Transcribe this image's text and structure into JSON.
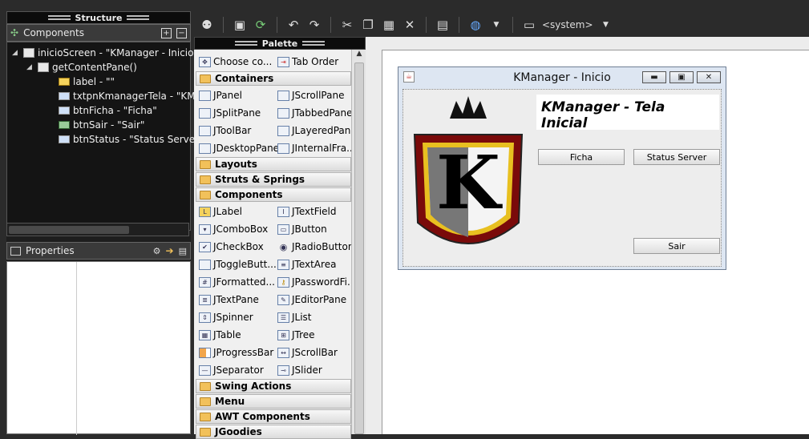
{
  "structure": {
    "title": "Structure",
    "components_header": "Components",
    "tree": [
      {
        "label": "inicioScreen - \"KManager - Inicio\""
      },
      {
        "label": "getContentPane()"
      },
      {
        "label": "label - \"\""
      },
      {
        "label": "txtpnKmanagerTela - \"KMa"
      },
      {
        "label": "btnFicha - \"Ficha\""
      },
      {
        "label": "btnSair - \"Sair\""
      },
      {
        "label": "btnStatus - \"Status Server\""
      }
    ]
  },
  "properties": {
    "header": "Properties"
  },
  "toolbar": {
    "system_combo": "<system>"
  },
  "palette": {
    "title": "Palette",
    "top_items": [
      "Choose co...",
      "Tab Order"
    ],
    "categories": {
      "containers": "Containers",
      "layouts": "Layouts",
      "struts": "Struts & Springs",
      "components": "Components",
      "swing_actions": "Swing Actions",
      "menu": "Menu",
      "awt": "AWT Components",
      "jgoodies": "JGoodies"
    },
    "containers": [
      "JPanel",
      "JScrollPane",
      "JSplitPane",
      "JTabbedPane",
      "JToolBar",
      "JLayeredPane",
      "JDesktopPane",
      "JInternalFra..."
    ],
    "components": [
      "JLabel",
      "JTextField",
      "JComboBox",
      "JButton",
      "JCheckBox",
      "JRadioButton",
      "JToggleButt...",
      "JTextArea",
      "JFormatted...",
      "JPasswordFi...",
      "JTextPane",
      "JEditorPane",
      "JSpinner",
      "JList",
      "JTable",
      "JTree",
      "JProgressBar",
      "JScrollBar",
      "JSeparator",
      "JSlider"
    ]
  },
  "frame": {
    "title": "KManager - Inicio",
    "header_text": "KManager - Tela Inicial",
    "btn_ficha": "Ficha",
    "btn_status": "Status Server",
    "btn_sair": "Sair",
    "logo_letter": "K"
  }
}
